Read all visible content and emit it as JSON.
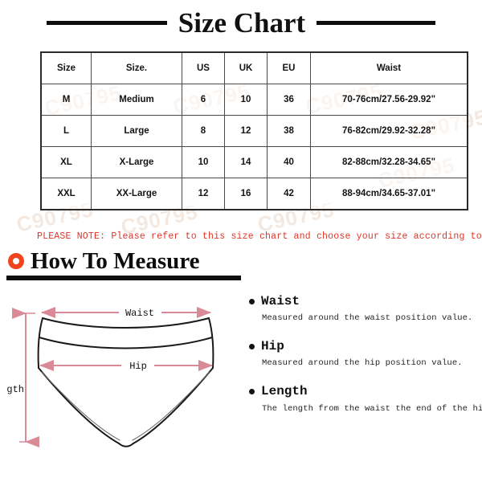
{
  "title": {
    "text": "Size Chart"
  },
  "size_table": {
    "headers": [
      "Size",
      "Size.",
      "US",
      "UK",
      "EU",
      "Waist"
    ],
    "rows": [
      {
        "size": "M",
        "size_name": "Medium",
        "us": "6",
        "uk": "10",
        "eu": "36",
        "waist": "70-76cm/27.56-29.92\""
      },
      {
        "size": "L",
        "size_name": "Large",
        "us": "8",
        "uk": "12",
        "eu": "38",
        "waist": "76-82cm/29.92-32.28\""
      },
      {
        "size": "XL",
        "size_name": "X-Large",
        "us": "10",
        "uk": "14",
        "eu": "40",
        "waist": "82-88cm/32.28-34.65\""
      },
      {
        "size": "XXL",
        "size_name": "XX-Large",
        "us": "12",
        "uk": "16",
        "eu": "42",
        "waist": "88-94cm/34.65-37.01\""
      }
    ]
  },
  "note": {
    "text": "PLEASE NOTE: Please refer to this size chart and choose your size according to it",
    "color": "#e03427"
  },
  "how_to_measure": {
    "heading": "How To Measure",
    "bullet_color": "#f0451c",
    "items": [
      {
        "label": "Waist",
        "description": "Measured around the waist position value."
      },
      {
        "label": "Hip",
        "description": "Measured around the hip position value."
      },
      {
        "label": "Length",
        "description": "The length from the waist the end of the hip."
      }
    ]
  },
  "diagram": {
    "arrow_color": "#d98a96",
    "outline_color": "#1a1a1a",
    "labels": {
      "waist": "Waist",
      "hip": "Hip",
      "length": "Length"
    }
  },
  "watermarks": {
    "text": "C90795"
  }
}
